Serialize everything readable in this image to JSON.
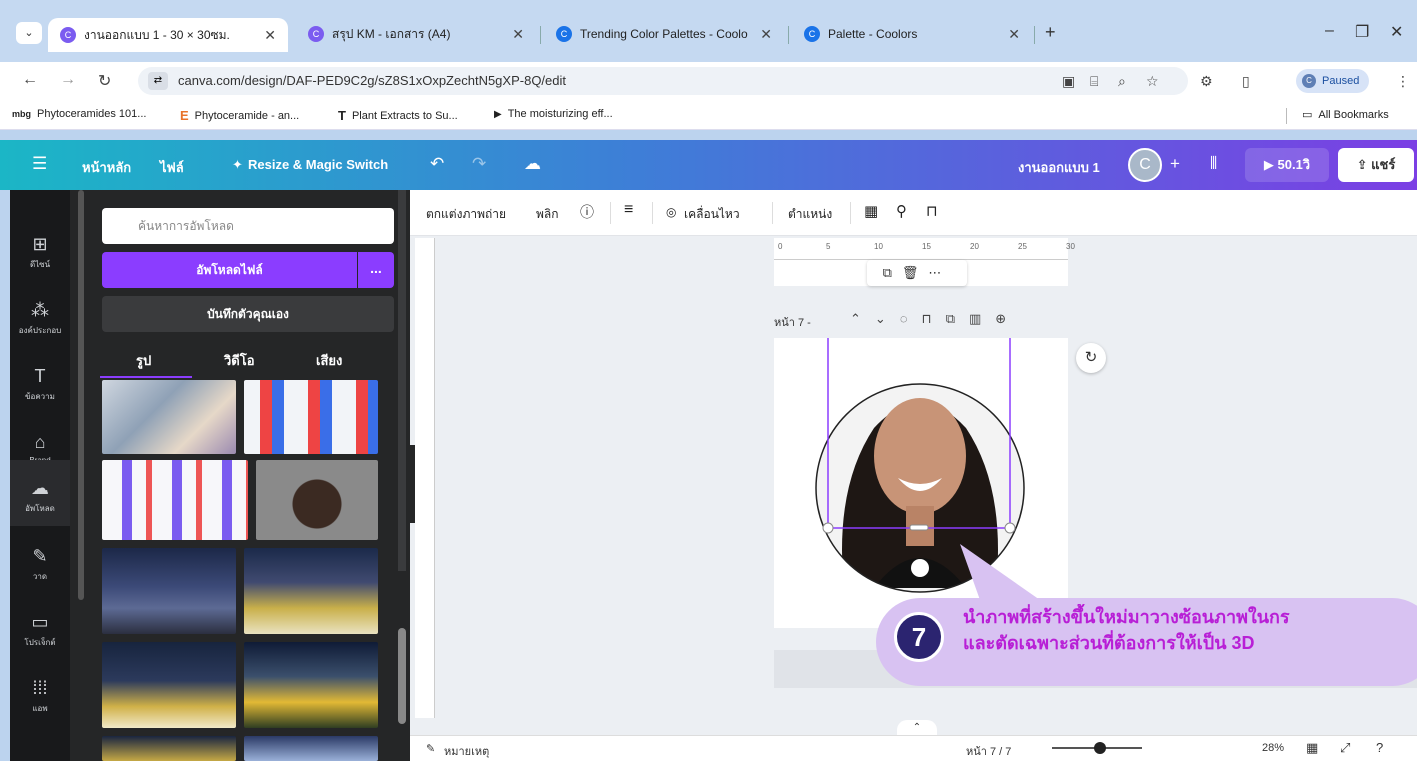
{
  "browser": {
    "tabs": [
      {
        "label": "งานออกแบบ 1 - 30 × 30ซม.",
        "active": true
      },
      {
        "label": "สรุป KM - เอกสาร (A4)",
        "active": false
      },
      {
        "label": "Trending Color Palettes - Coolo",
        "active": false
      },
      {
        "label": "Palette - Coolors",
        "active": false
      }
    ],
    "url": "canva.com/design/DAF-PED9C2g/sZ8S1xOxpZechtN5gXP-8Q/edit",
    "profile_status": "Paused",
    "bookmarks": [
      {
        "label": "Phytoceramides 101...",
        "icon": "mbg"
      },
      {
        "label": "Phytoceramide - an...",
        "icon": "E"
      },
      {
        "label": "Plant Extracts to Su...",
        "icon": "T"
      },
      {
        "label": "The moisturizing eff...",
        "icon": "▶"
      }
    ],
    "all_bookmarks": "All Bookmarks"
  },
  "header": {
    "home": "หน้าหลัก",
    "file": "ไฟล์",
    "resize": "Resize & Magic Switch",
    "design_name": "งานออกแบบ 1",
    "avatar_letter": "C",
    "present_label": "50.1วิ",
    "share_label": "แชร์"
  },
  "rail": [
    {
      "label": "ดีไซน์",
      "icon": "⊞"
    },
    {
      "label": "องค์ประกอบ",
      "icon": "⁂"
    },
    {
      "label": "ข้อความ",
      "icon": "T"
    },
    {
      "label": "Brand",
      "icon": "⌂"
    },
    {
      "label": "อัพโหลด",
      "icon": "☁"
    },
    {
      "label": "วาด",
      "icon": "✎"
    },
    {
      "label": "โปรเจ็กต์",
      "icon": "▭"
    },
    {
      "label": "แอพ",
      "icon": "⁞⁞⁞"
    }
  ],
  "panel": {
    "search_placeholder": "ค้นหาการอัพโหลด",
    "upload_button": "อัพโหลดไฟล์",
    "more": "...",
    "record_button": "บันทึกตัวคุณเอง",
    "tabs": [
      "รูป",
      "วิดีโอ",
      "เสียง"
    ]
  },
  "toolbar": {
    "edit_photo": "ตกแต่งภาพถ่าย",
    "flip": "พลิก",
    "animate": "เคลื่อนไหว",
    "position": "ตำแหน่ง"
  },
  "ruler": [
    "0",
    "5",
    "10",
    "15",
    "20",
    "25",
    "30"
  ],
  "page": {
    "label": "หน้า 7 -",
    "indicator": "หน้า 7 / 7"
  },
  "bottom": {
    "notes": "หมายเหตุ",
    "zoom": "28%"
  },
  "callout": {
    "step": "7",
    "line1": "นำภาพที่สร้างขึ้นใหม่มาวางซ้อนภาพในกร",
    "line2": "และตัดเฉพาะส่วนที่ต้องการให้เป็น 3D"
  }
}
